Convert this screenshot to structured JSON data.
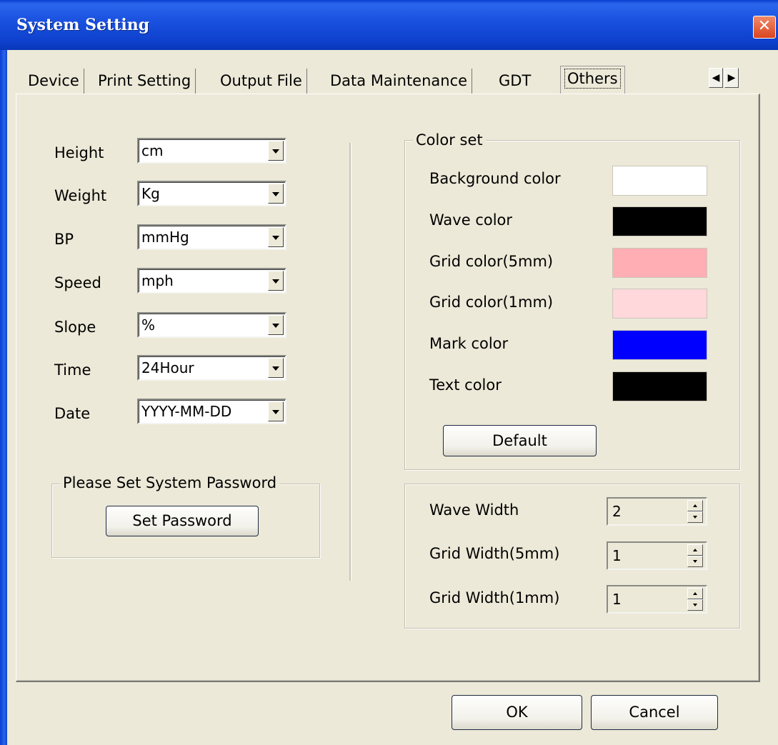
{
  "window": {
    "title": "System Setting",
    "close_symbol": "✕"
  },
  "tabs": [
    "Device",
    "Print Setting",
    "Output File",
    "Data Maintenance",
    "GDT",
    "Others"
  ],
  "tab_scroll": {
    "left": "◀",
    "right": "▶"
  },
  "units": {
    "height": {
      "label": "Height",
      "value": "cm"
    },
    "weight": {
      "label": "Weight",
      "value": "Kg"
    },
    "bp": {
      "label": "BP",
      "value": "mmHg"
    },
    "speed": {
      "label": "Speed",
      "value": "mph"
    },
    "slope": {
      "label": "Slope",
      "value": "%"
    },
    "time": {
      "label": "Time",
      "value": "24Hour"
    },
    "date": {
      "label": "Date",
      "value": "YYYY-MM-DD"
    }
  },
  "password": {
    "group_label": "Please Set System Password",
    "button": "Set Password"
  },
  "color_set": {
    "group_label": "Color set",
    "items": [
      {
        "label": "Background color",
        "color": "#ffffff"
      },
      {
        "label": "Wave color",
        "color": "#000000"
      },
      {
        "label": "Grid color(5mm)",
        "color": "#ffaeb4"
      },
      {
        "label": "Grid color(1mm)",
        "color": "#ffd8dc"
      },
      {
        "label": "Mark color",
        "color": "#0000ff"
      },
      {
        "label": "Text color",
        "color": "#000000"
      }
    ],
    "default_button": "Default"
  },
  "widths": [
    {
      "label": "Wave Width",
      "value": "2"
    },
    {
      "label": "Grid Width(5mm)",
      "value": "1"
    },
    {
      "label": "Grid Width(1mm)",
      "value": "1"
    }
  ],
  "footer": {
    "ok": "OK",
    "cancel": "Cancel"
  }
}
